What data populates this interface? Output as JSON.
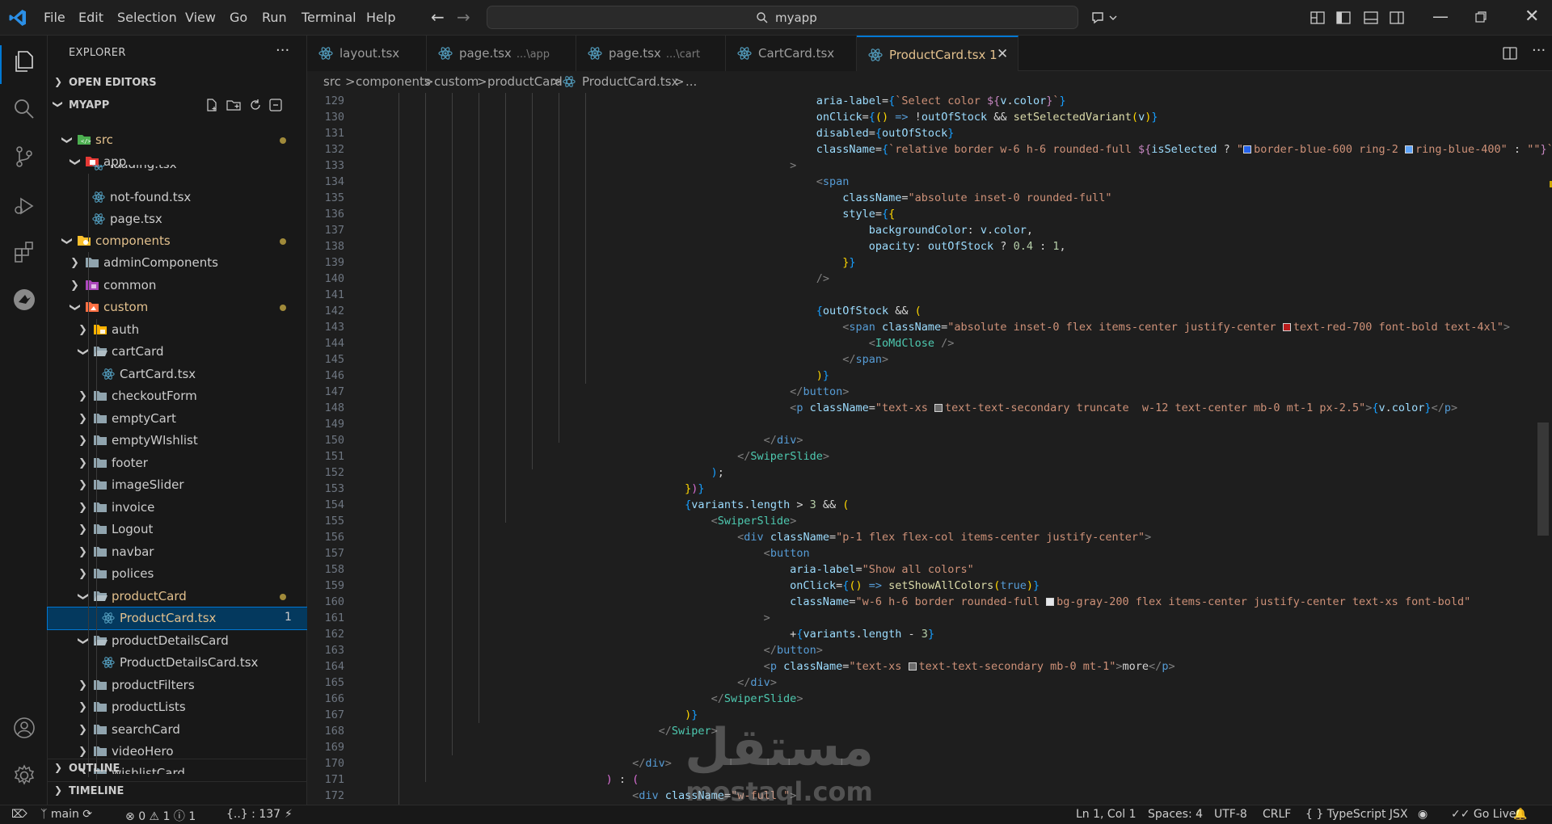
{
  "menu": [
    "File",
    "Edit",
    "Selection",
    "View",
    "Go",
    "Run",
    "Terminal",
    "Help"
  ],
  "search": {
    "text": "myapp"
  },
  "sidebar": {
    "title": "EXPLORER",
    "more": "···",
    "open_editors": "OPEN EDITORS",
    "workspace": "MYAPP",
    "outline": "OUTLINE",
    "timeline": "TIMELINE",
    "tree": [
      {
        "label": "src"
      },
      {
        "label": "app"
      },
      {
        "label": "loading.tsx"
      },
      {
        "label": "not-found.tsx"
      },
      {
        "label": "page.tsx"
      },
      {
        "label": "components"
      },
      {
        "label": "adminComponents"
      },
      {
        "label": "common"
      },
      {
        "label": "custom"
      },
      {
        "label": "auth"
      },
      {
        "label": "cartCard"
      },
      {
        "label": "CartCard.tsx"
      },
      {
        "label": "checkoutForm"
      },
      {
        "label": "emptyCart"
      },
      {
        "label": "emptyWIshlist"
      },
      {
        "label": "footer"
      },
      {
        "label": "imageSlider"
      },
      {
        "label": "invoice"
      },
      {
        "label": "Logout"
      },
      {
        "label": "navbar"
      },
      {
        "label": "polices"
      },
      {
        "label": "productCard"
      },
      {
        "label": "ProductCard.tsx",
        "badge": "1"
      },
      {
        "label": "productDetailsCard"
      },
      {
        "label": "ProductDetailsCard.tsx"
      },
      {
        "label": "productFilters"
      },
      {
        "label": "productLists"
      },
      {
        "label": "searchCard"
      },
      {
        "label": "videoHero"
      },
      {
        "label": "wishlistCard"
      }
    ]
  },
  "tabs": [
    {
      "label": "layout.tsx",
      "desc": ""
    },
    {
      "label": "page.tsx",
      "desc": "...\\app"
    },
    {
      "label": "page.tsx",
      "desc": "...\\cart"
    },
    {
      "label": "CartCard.tsx",
      "desc": ""
    },
    {
      "label": "ProductCard.tsx 1",
      "desc": ""
    }
  ],
  "breadcrumb": [
    "src",
    ">",
    "components",
    ">",
    "custom",
    ">",
    "productCard",
    ">",
    "ProductCard.tsx",
    ">",
    "..."
  ],
  "editor": {
    "line_numbers": [
      "129",
      "130",
      "131",
      "132",
      "133",
      "134",
      "135",
      "136",
      "137",
      "138",
      "139",
      "140",
      "141",
      "142",
      "143",
      "144",
      "145",
      "146",
      "147",
      "148",
      "149",
      "150",
      "151",
      "152",
      "153",
      "154",
      "155",
      "156",
      "157",
      "158",
      "159",
      "160",
      "161",
      "162",
      "163",
      "164",
      "165",
      "166",
      "167",
      "168",
      "169",
      "170",
      "171",
      "172"
    ]
  },
  "status": {
    "branch": "main",
    "errors": "0",
    "warnings": "1",
    "info": "1",
    "lines": "{..} : 137",
    "position": "Ln 1, Col 1",
    "spaces": "Spaces: 4",
    "encoding": "UTF-8",
    "eol": "CRLF",
    "language": "{ } TypeScript JSX",
    "golive": "Go Live"
  },
  "watermark": {
    "arabic": "مستقل",
    "latin": "mostaql.com"
  }
}
